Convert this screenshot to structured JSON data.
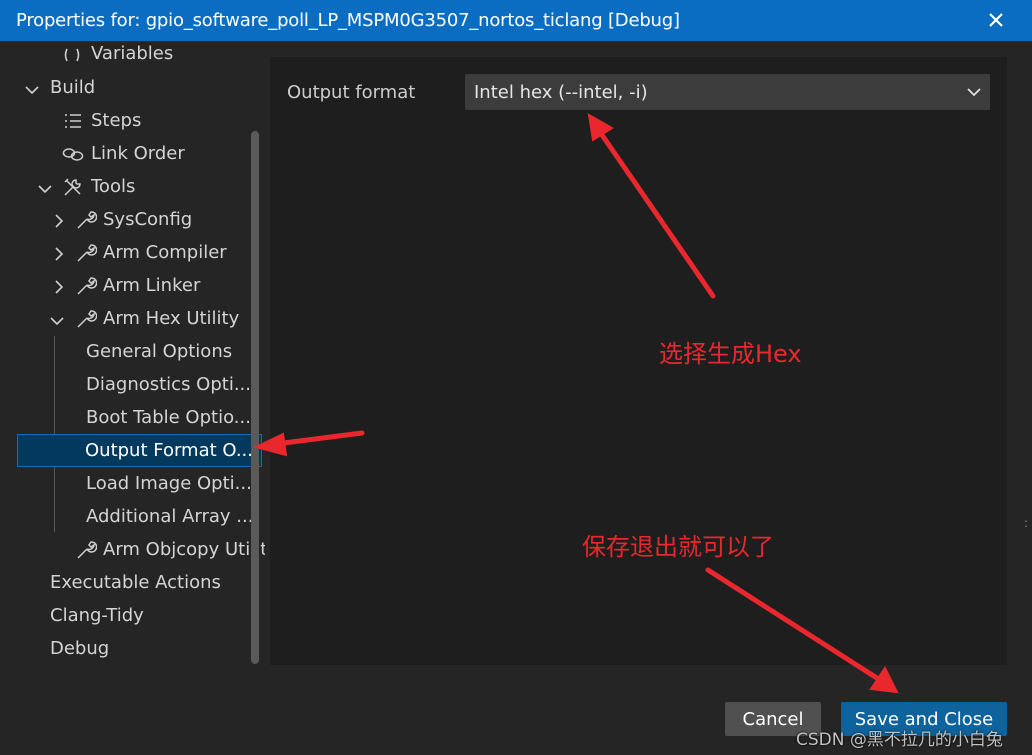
{
  "window": {
    "title": "Properties for: gpio_software_poll_LP_MSPM0G3507_nortos_ticlang [Debug]",
    "close_icon": "close-icon"
  },
  "sidebar": {
    "items": [
      {
        "label": "Variables",
        "icon": "variables-icon"
      },
      {
        "label": "Build",
        "icon": "chevron-down-icon"
      },
      {
        "label": "Steps",
        "icon": "list-icon"
      },
      {
        "label": "Link Order",
        "icon": "link-icon"
      },
      {
        "label": "Tools",
        "icon": "tools-icon"
      },
      {
        "label": "SysConfig",
        "icon": "wrench-icon"
      },
      {
        "label": "Arm Compiler",
        "icon": "wrench-icon"
      },
      {
        "label": "Arm Linker",
        "icon": "wrench-icon"
      },
      {
        "label": "Arm Hex Utility",
        "icon": "wrench-icon"
      },
      {
        "label": "General Options"
      },
      {
        "label": "Diagnostics Opti..."
      },
      {
        "label": "Boot Table Optio..."
      },
      {
        "label": "Output Format O...",
        "selected": true
      },
      {
        "label": "Load Image Opti..."
      },
      {
        "label": "Additional Array ..."
      },
      {
        "label": "Arm Objcopy Utilit",
        "icon": "wrench-icon"
      },
      {
        "label": "Executable Actions"
      },
      {
        "label": "Clang-Tidy"
      },
      {
        "label": "Debug"
      }
    ]
  },
  "main": {
    "output_format_label": "Output format",
    "output_format_value": "Intel hex (--intel, -i)"
  },
  "annotations": {
    "select_hex": "选择生成Hex",
    "save_exit": "保存退出就可以了"
  },
  "buttons": {
    "cancel": "Cancel",
    "save_close": "Save and Close"
  },
  "watermark": "CSDN @黑不拉几的小白兔",
  "colors": {
    "titlebar": "#0a6dc2",
    "selection": "#04395e",
    "primary_button": "#0e639c",
    "annotation_red": "#e8282d"
  }
}
